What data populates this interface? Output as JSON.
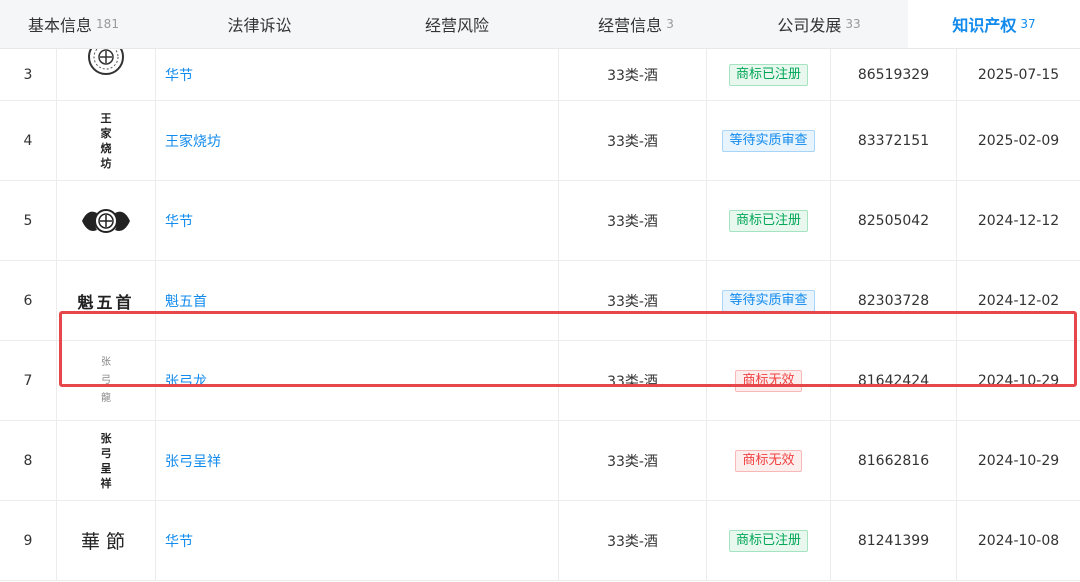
{
  "tabs": [
    {
      "label": "基本信息",
      "count": "181"
    },
    {
      "label": "法律诉讼",
      "count": ""
    },
    {
      "label": "经营风险",
      "count": ""
    },
    {
      "label": "经营信息",
      "count": "3"
    },
    {
      "label": "公司发展",
      "count": "33"
    },
    {
      "label": "知识产权",
      "count": "37"
    }
  ],
  "active_tab": "知识产权",
  "rows": [
    {
      "idx": "3",
      "name": "华节",
      "class": "33类-酒",
      "status": "商标已注册",
      "number": "86519329",
      "date": "2025-07-15",
      "logo_text": ""
    },
    {
      "idx": "4",
      "name": "王家烧坊",
      "class": "33类-酒",
      "status": "等待实质审查",
      "number": "83372151",
      "date": "2025-02-09",
      "logo_text": "王家烧坊"
    },
    {
      "idx": "5",
      "name": "华节",
      "class": "33类-酒",
      "status": "商标已注册",
      "number": "82505042",
      "date": "2024-12-12",
      "logo_text": ""
    },
    {
      "idx": "6",
      "name": "魁五首",
      "class": "33类-酒",
      "status": "等待实质审查",
      "number": "82303728",
      "date": "2024-12-02",
      "logo_text": "魁五首"
    },
    {
      "idx": "7",
      "name": "张弓龙",
      "class": "33类-酒",
      "status": "商标无效",
      "number": "81642424",
      "date": "2024-10-29",
      "logo_text": "张弓龍"
    },
    {
      "idx": "8",
      "name": "张弓呈祥",
      "class": "33类-酒",
      "status": "商标无效",
      "number": "81662816",
      "date": "2024-10-29",
      "logo_text": "张弓呈祥"
    },
    {
      "idx": "9",
      "name": "华节",
      "class": "33类-酒",
      "status": "商标已注册",
      "number": "81241399",
      "date": "2024-10-08",
      "logo_text": "華節"
    }
  ],
  "colors": {
    "accent": "#128bed",
    "highlight_border": "#e5474a",
    "registered": "#00a656",
    "pending": "#128bed",
    "invalid": "#f04040"
  }
}
